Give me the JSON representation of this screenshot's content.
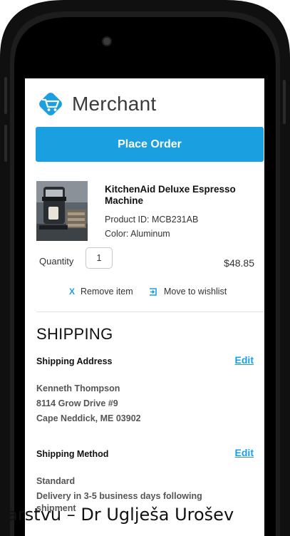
{
  "brand": {
    "name": "Merchant"
  },
  "cart": {
    "place_order": "Place Order",
    "product": {
      "title": "KitchenAid Deluxe Espresso Machine",
      "product_id": "Product ID: MCB231AB",
      "color": "Color: Aluminum"
    },
    "quantity_label": "Quantity",
    "quantity_value": "1",
    "price": "$48.85",
    "remove_label": "Remove item",
    "remove_glyph": "X",
    "wishlist_label": "Move to wishlist"
  },
  "shipping": {
    "title": "SHIPPING",
    "address_heading": "Shipping Address",
    "address_edit": "Edit",
    "address_lines": [
      "Kenneth Thompson",
      "8114 Grow Drive #9",
      "Cape Neddick, ME 03902"
    ],
    "method_heading": "Shipping Method",
    "method_edit": "Edit",
    "method_name": "Standard",
    "method_desc_1": "Delivery in 3-5 business days following",
    "method_desc_2": "shipment"
  },
  "overlay_caption": "narstvu – Dr Uglješa Urošev",
  "colors": {
    "accent": "#1aa0e0",
    "phone_body": "#1c1c1c"
  }
}
